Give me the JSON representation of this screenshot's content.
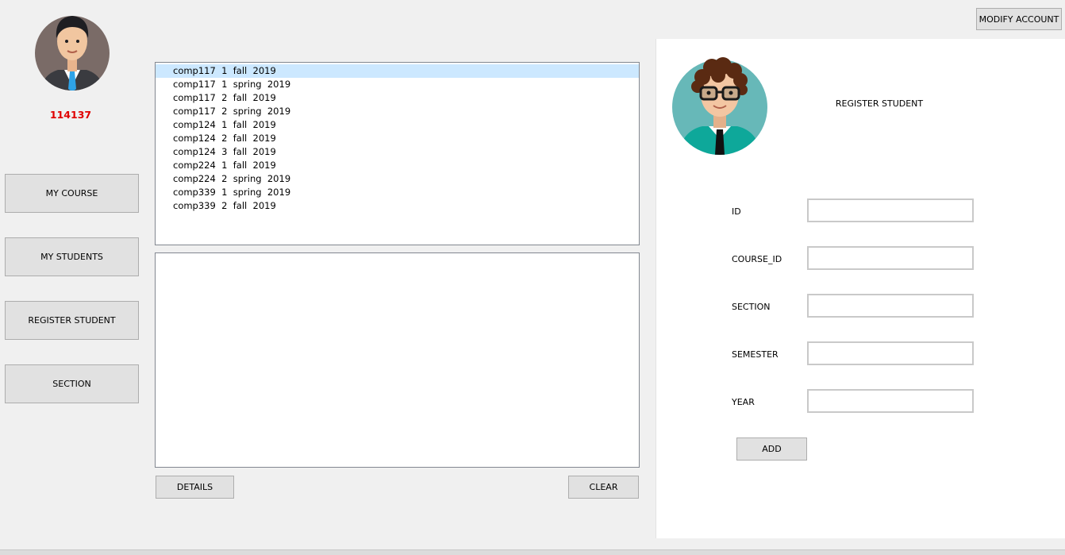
{
  "user": {
    "id_label": "114137",
    "accent": "#e00000"
  },
  "sidebar": {
    "items": [
      {
        "label": "MY COURSE"
      },
      {
        "label": "MY STUDENTS"
      },
      {
        "label": "REGISTER STUDENT"
      },
      {
        "label": "SECTION"
      }
    ]
  },
  "course_list": {
    "items": [
      "comp117  1  fall  2019",
      "comp117  1  spring  2019",
      "comp117  2  fall  2019",
      "comp117  2  spring  2019",
      "comp124  1  fall  2019",
      "comp124  2  fall  2019",
      "comp124  3  fall  2019",
      "comp224  1  fall  2019",
      "comp224  2  spring  2019",
      "comp339  1  spring  2019",
      "comp339  2  fall  2019"
    ],
    "selected_index": 0
  },
  "actions": {
    "details_label": "DETAILS",
    "clear_label": "CLEAR"
  },
  "header": {
    "modify_account_label": "MODIFY ACCOUNT"
  },
  "register_form": {
    "title": "REGISTER STUDENT",
    "fields": [
      {
        "label": "ID",
        "value": ""
      },
      {
        "label": "COURSE_ID",
        "value": ""
      },
      {
        "label": "SECTION",
        "value": ""
      },
      {
        "label": "SEMESTER",
        "value": ""
      },
      {
        "label": "YEAR",
        "value": ""
      }
    ],
    "add_label": "ADD"
  },
  "icons": {
    "teacher_avatar": "man-avatar-icon",
    "student_avatar": "student-avatar-icon"
  }
}
